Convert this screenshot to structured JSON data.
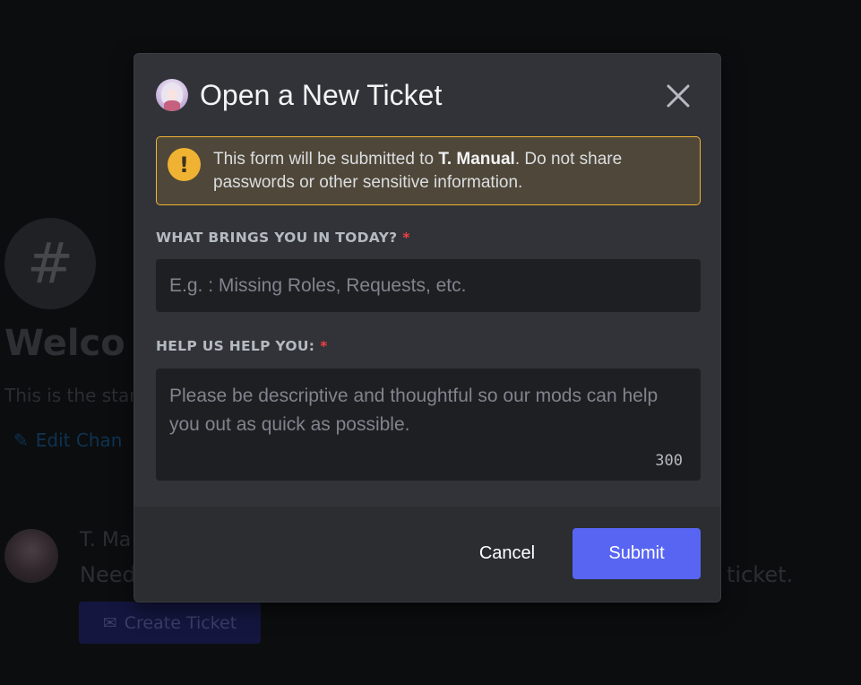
{
  "background": {
    "hash_symbol": "#",
    "welcome_text": "Welco",
    "start_text": "This is the star",
    "edit_icon": "pencil-icon",
    "edit_text": "Edit Chan",
    "author": "T. Ma",
    "message_start": "Need",
    "message_end": "ticket.",
    "create_ticket_icon": "envelope-icon",
    "create_ticket_label": "Create Ticket"
  },
  "modal": {
    "avatar": "bot-avatar",
    "title": "Open a New Ticket",
    "close_icon": "close-icon",
    "warning": {
      "icon": "exclamation-icon",
      "text_before": "This form will be submitted to ",
      "bold_name": "T. Manual",
      "text_after": ". Do not share passwords or other sensitive information.",
      "color": "#f0b232"
    },
    "fields": [
      {
        "label": "WHAT BRINGS YOU IN TODAY?",
        "required_marker": "*",
        "placeholder": "E.g. : Missing Roles, Requests, etc.",
        "value": ""
      },
      {
        "label": "HELP US HELP YOU:",
        "required_marker": "*",
        "placeholder": "Please be descriptive and thoughtful so our mods can help you out as quick as possible.",
        "value": "",
        "remaining_chars": "300"
      }
    ],
    "footer": {
      "cancel_label": "Cancel",
      "submit_label": "Submit",
      "submit_color": "#5865f2"
    }
  }
}
